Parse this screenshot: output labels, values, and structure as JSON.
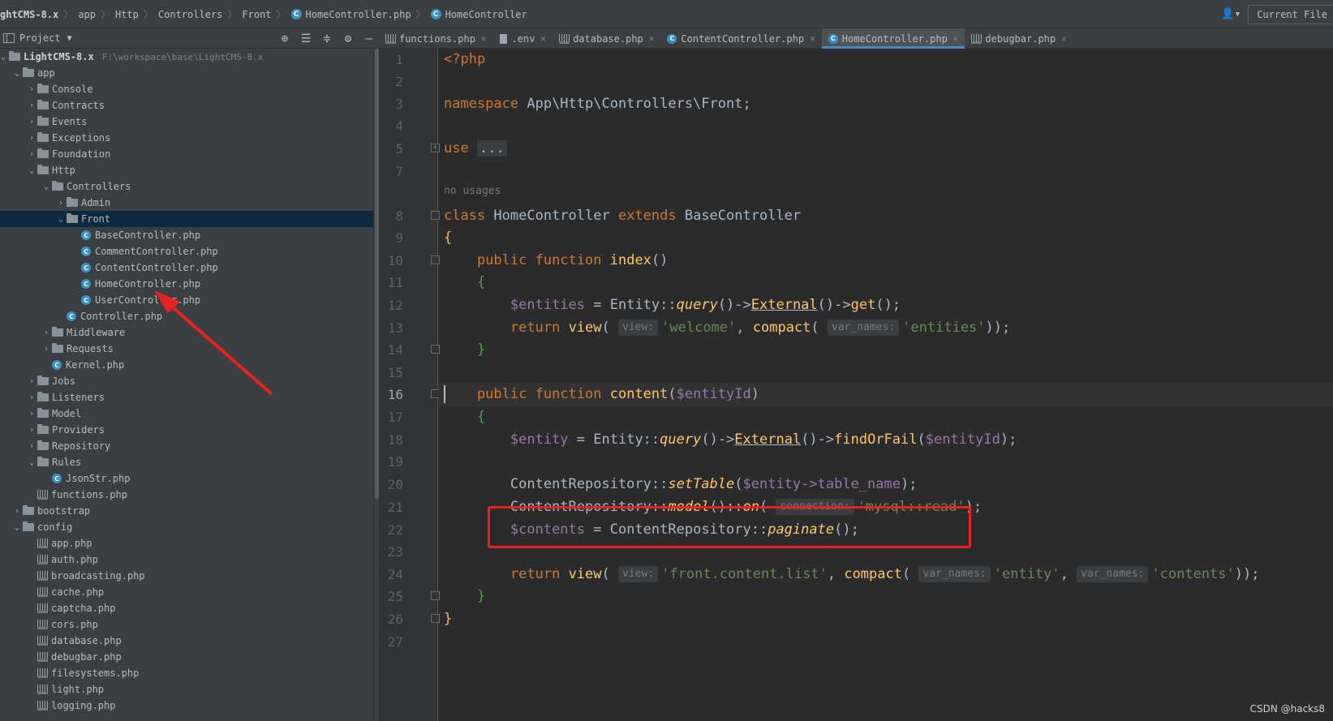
{
  "breadcrumb": {
    "items": [
      "ghtCMS-8.x",
      "app",
      "Http",
      "Controllers",
      "Front",
      "HomeController.php",
      "HomeController"
    ]
  },
  "top_right": {
    "current_file_label": "Current File"
  },
  "project_panel": {
    "title": "Project",
    "root_label": "LightCMS-8.x",
    "root_path": "F:\\workspace\\base\\LightCMS-8.x",
    "tree": [
      {
        "label": "app",
        "type": "folder",
        "level": 1,
        "expanded": true
      },
      {
        "label": "Console",
        "type": "folder",
        "level": 2
      },
      {
        "label": "Contracts",
        "type": "folder",
        "level": 2
      },
      {
        "label": "Events",
        "type": "folder",
        "level": 2
      },
      {
        "label": "Exceptions",
        "type": "folder",
        "level": 2
      },
      {
        "label": "Foundation",
        "type": "folder",
        "level": 2
      },
      {
        "label": "Http",
        "type": "folder",
        "level": 2,
        "expanded": true
      },
      {
        "label": "Controllers",
        "type": "folder",
        "level": 3,
        "expanded": true
      },
      {
        "label": "Admin",
        "type": "folder",
        "level": 4
      },
      {
        "label": "Front",
        "type": "folder",
        "level": 4,
        "expanded": true,
        "selected": true
      },
      {
        "label": "BaseController.php",
        "type": "class",
        "level": 5
      },
      {
        "label": "CommentController.php",
        "type": "class",
        "level": 5
      },
      {
        "label": "ContentController.php",
        "type": "class",
        "level": 5
      },
      {
        "label": "HomeController.php",
        "type": "class",
        "level": 5
      },
      {
        "label": "UserController.php",
        "type": "class",
        "level": 5
      },
      {
        "label": "Controller.php",
        "type": "class",
        "level": 4
      },
      {
        "label": "Middleware",
        "type": "folder",
        "level": 3
      },
      {
        "label": "Requests",
        "type": "folder",
        "level": 3
      },
      {
        "label": "Kernel.php",
        "type": "class",
        "level": 3
      },
      {
        "label": "Jobs",
        "type": "folder",
        "level": 2
      },
      {
        "label": "Listeners",
        "type": "folder",
        "level": 2
      },
      {
        "label": "Model",
        "type": "folder",
        "level": 2
      },
      {
        "label": "Providers",
        "type": "folder",
        "level": 2
      },
      {
        "label": "Repository",
        "type": "folder",
        "level": 2
      },
      {
        "label": "Rules",
        "type": "folder",
        "level": 2,
        "expanded": true
      },
      {
        "label": "JsonStr.php",
        "type": "class",
        "level": 3
      },
      {
        "label": "functions.php",
        "type": "php",
        "level": 2
      },
      {
        "label": "bootstrap",
        "type": "folder",
        "level": 1
      },
      {
        "label": "config",
        "type": "folder",
        "level": 1,
        "expanded": true
      },
      {
        "label": "app.php",
        "type": "php",
        "level": 2
      },
      {
        "label": "auth.php",
        "type": "php",
        "level": 2
      },
      {
        "label": "broadcasting.php",
        "type": "php",
        "level": 2
      },
      {
        "label": "cache.php",
        "type": "php",
        "level": 2
      },
      {
        "label": "captcha.php",
        "type": "php",
        "level": 2
      },
      {
        "label": "cors.php",
        "type": "php",
        "level": 2
      },
      {
        "label": "database.php",
        "type": "php",
        "level": 2
      },
      {
        "label": "debugbar.php",
        "type": "php",
        "level": 2
      },
      {
        "label": "filesystems.php",
        "type": "php",
        "level": 2
      },
      {
        "label": "light.php",
        "type": "php",
        "level": 2
      },
      {
        "label": "logging.php",
        "type": "php",
        "level": 2
      }
    ]
  },
  "tabs": [
    {
      "label": "functions.php",
      "icon": "php-file-icon"
    },
    {
      "label": ".env",
      "icon": "env-file-icon"
    },
    {
      "label": "database.php",
      "icon": "php-file-icon"
    },
    {
      "label": "ContentController.php",
      "icon": "class-icon"
    },
    {
      "label": "HomeController.php",
      "icon": "class-icon",
      "active": true
    },
    {
      "label": "debugbar.php",
      "icon": "php-file-icon"
    }
  ],
  "editor": {
    "current_line": 16,
    "line_numbers": [
      "1",
      "2",
      "3",
      "4",
      "5",
      "7",
      "8",
      "9",
      "10",
      "11",
      "12",
      "13",
      "14",
      "15",
      "16",
      "17",
      "18",
      "19",
      "20",
      "21",
      "22",
      "23",
      "24",
      "25",
      "26",
      "27"
    ],
    "no_usages_hint": "no usages",
    "code": {
      "l1": "<?php",
      "l3_kw": "namespace",
      "l3_ns": " App\\Http\\Controllers\\Front;",
      "l5_kw": "use",
      "l5_dots": "...",
      "l8_class": "class",
      "l8_name": " HomeController ",
      "l8_extends": "extends",
      "l8_base": " BaseController",
      "brace_open": "{",
      "brace_close": "}",
      "public_function": "public function",
      "index": "index",
      "index_parens": "()",
      "entities_var": "$entities",
      "assign": " = ",
      "entity_class": "Entity::",
      "query": "query",
      "arrow": "()->",
      "external": "External",
      "get": "get",
      "end_call": "();",
      "return_kw": "return",
      "view_fn": "view",
      "hint_view": "view:",
      "welcome_str": "'welcome'",
      "comma": ", ",
      "compact_fn": "compact",
      "hint_var_names": "var_names:",
      "entities_str": "'entities'",
      "close_2": "));",
      "content_fn": "content",
      "entity_id_var": "$entityId",
      "entity_var": "$entity",
      "find_or_fail": "findOrFail",
      "repo_class": "ContentRepository::",
      "set_table": "setTable",
      "table_name_arg": "$entity->table_name",
      "model": "model",
      "on": "on",
      "hint_connection": "connection:",
      "mysql_read": "'mysql::read'",
      "contents_var": "$contents",
      "paginate": "paginate",
      "front_list_str": "'front.content.list'",
      "entity_str": "'entity'",
      "contents_str": "'contents'"
    }
  },
  "watermark": "CSDN @hacks8"
}
